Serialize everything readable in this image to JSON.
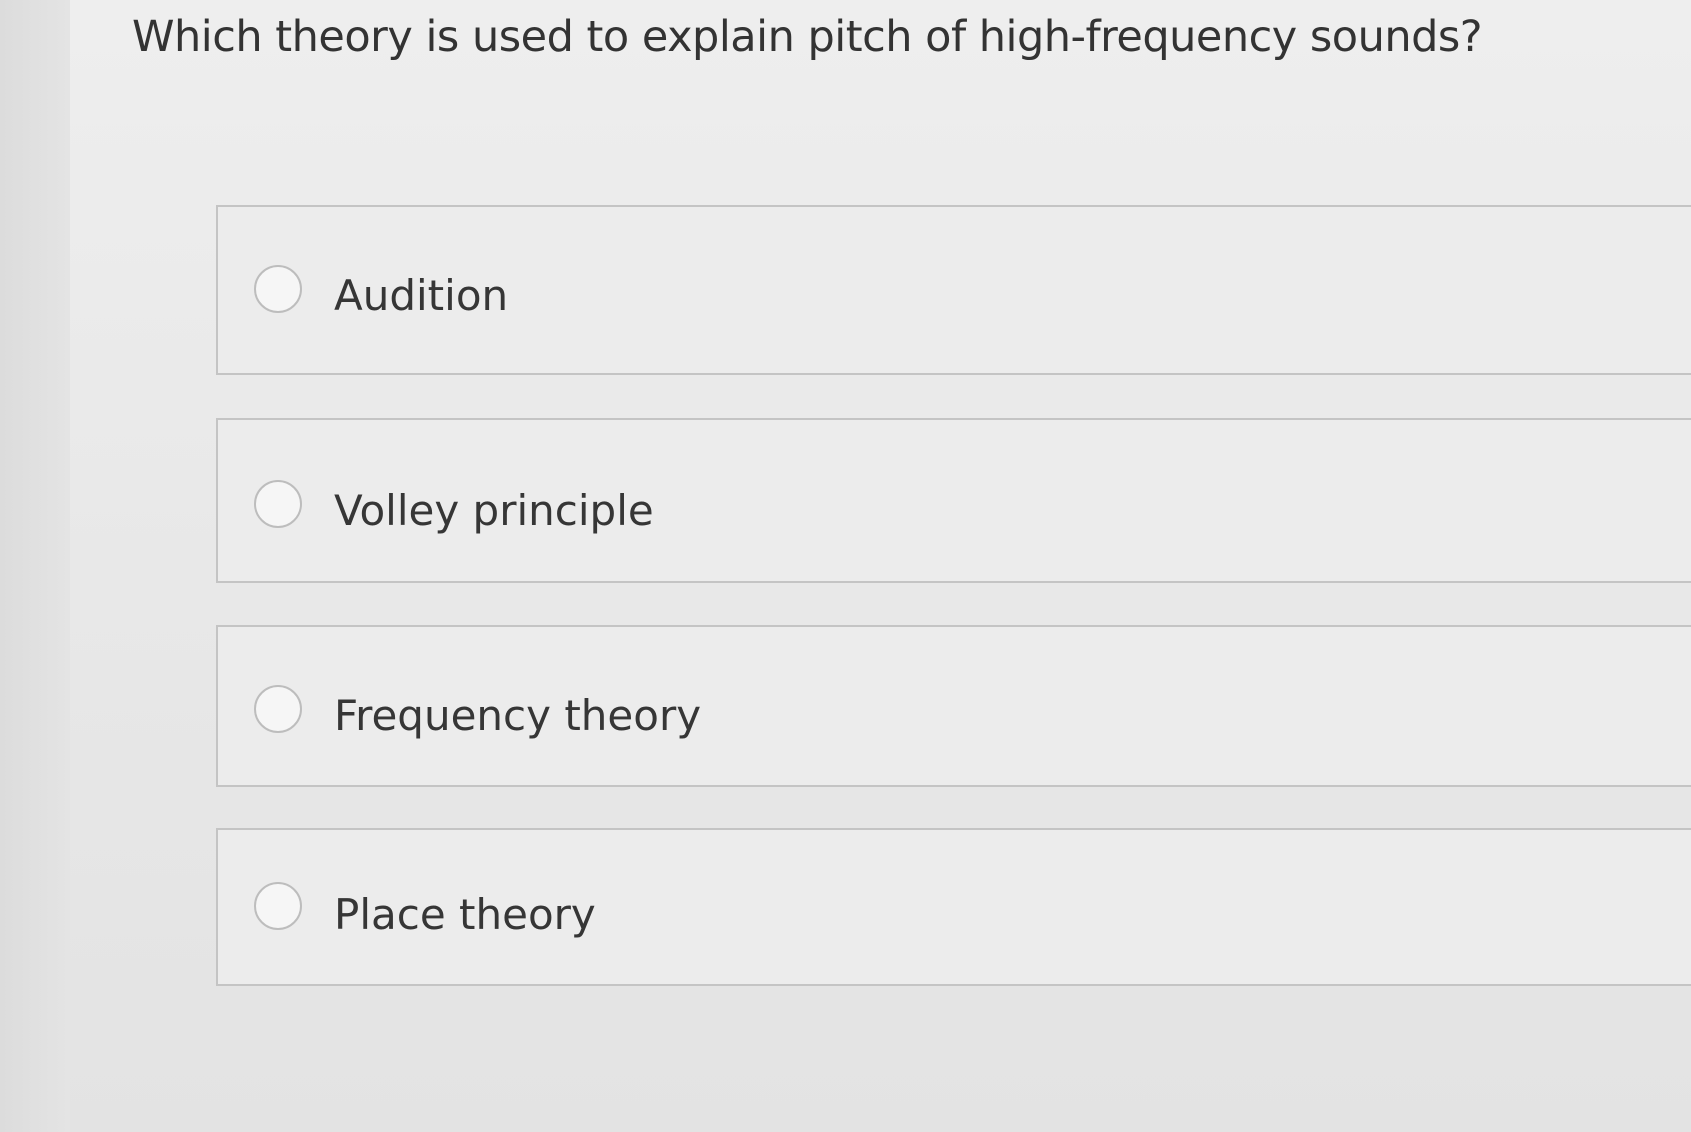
{
  "question": {
    "text": "Which theory is used to explain pitch of high-frequency sounds?"
  },
  "options": [
    {
      "label": "Audition",
      "selected": false
    },
    {
      "label": "Volley principle",
      "selected": false
    },
    {
      "label": "Frequency theory",
      "selected": false
    },
    {
      "label": "Place theory",
      "selected": false
    }
  ]
}
